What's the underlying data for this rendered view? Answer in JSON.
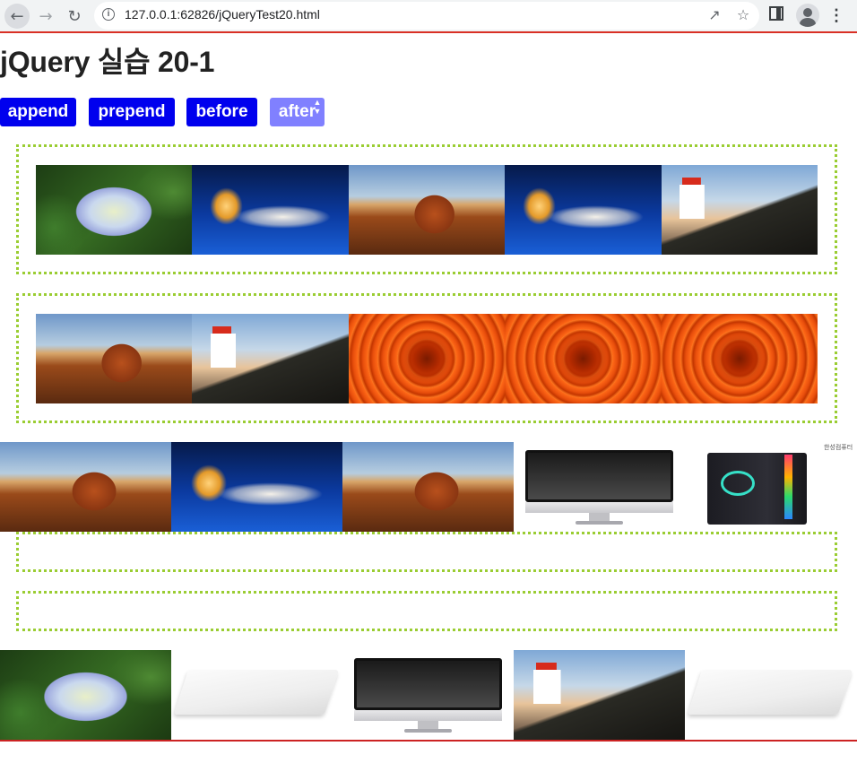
{
  "browser": {
    "url": "127.0.0.1:62826/jQueryTest20.html",
    "icons": [
      "back-arrow-icon",
      "forward-arrow-icon",
      "reload-icon",
      "info-icon",
      "share-icon",
      "star-icon",
      "side-panel-icon",
      "profile-icon",
      "menu-icon"
    ]
  },
  "page": {
    "title": "jQuery 실습 20-1"
  },
  "buttons": {
    "append": "append",
    "prepend": "prepend",
    "before": "before",
    "after": "after"
  },
  "colors": {
    "button_bg": "#0000ee",
    "button_hover_bg": "#8080ff",
    "box_border": "#9acd32",
    "divider": "#cc2222"
  },
  "rows": {
    "box1_images": [
      "hydrangea",
      "jellyfish",
      "desert",
      "jellyfish",
      "lighthouse"
    ],
    "box2_images": [
      "desert",
      "lighthouse",
      "flower",
      "flower",
      "flower"
    ],
    "outside_before_box3": [
      "desert",
      "jellyfish",
      "desert",
      "imac",
      "pc-case"
    ],
    "box3_images": [],
    "box4_images": [],
    "outside_after_box4": [
      "hydrangea",
      "laptop",
      "imac",
      "lighthouse",
      "laptop"
    ]
  },
  "image_text": {
    "pc_case_label": "한성컴퓨터"
  }
}
